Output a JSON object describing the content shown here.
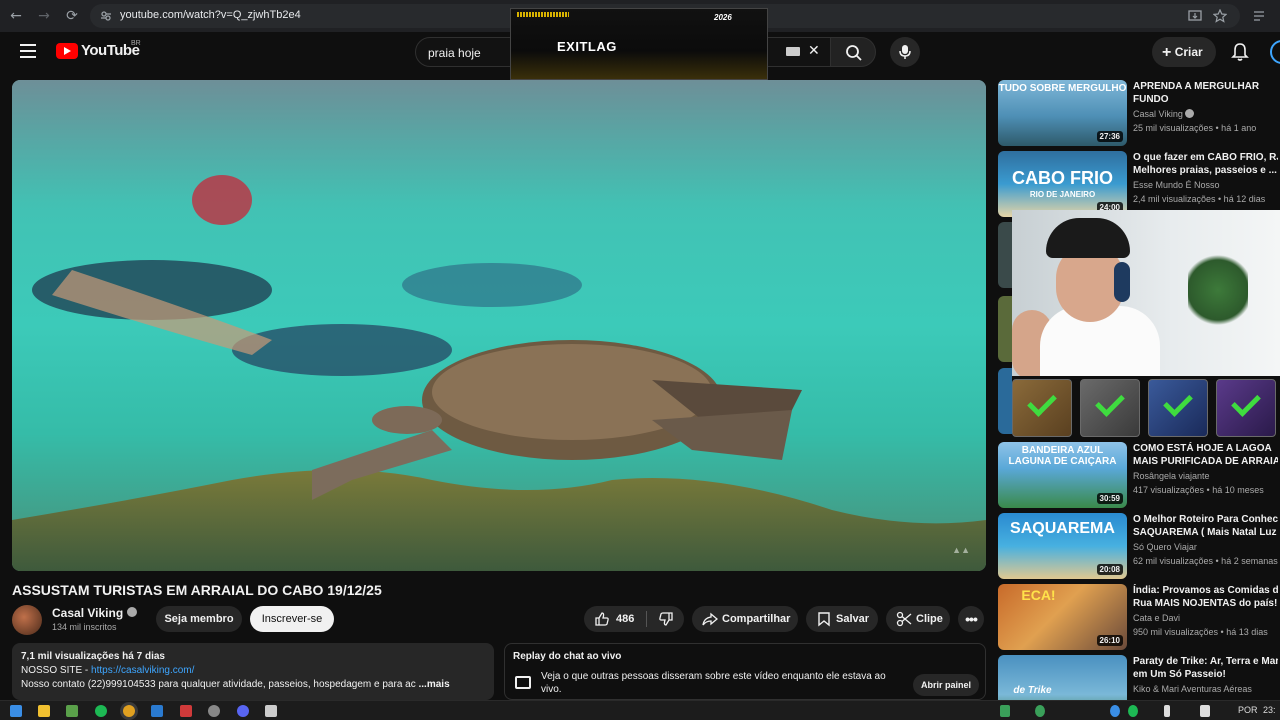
{
  "browser": {
    "url": "youtube.com/watch?v=Q_zjwhTb2e4",
    "back_icon": "arrow-left-icon",
    "forward_icon": "arrow-right-icon",
    "reload_icon": "reload-icon"
  },
  "header": {
    "logo_text": "YouTube",
    "country_code": "BR",
    "search_value": "praia hoje",
    "create_label": "Criar"
  },
  "overlay": {
    "brand": "EXITLAG",
    "year": "2026"
  },
  "video": {
    "title": "ASSUSTAM TURISTAS EM ARRAIAL DO CABO 19/12/25"
  },
  "channel": {
    "name": "Casal Viking",
    "subscribers": "134 mil inscritos",
    "member_label": "Seja membro",
    "subscribe_label": "Inscrever-se"
  },
  "actions": {
    "likes": "486",
    "share_label": "Compartilhar",
    "save_label": "Salvar",
    "clip_label": "Clipe"
  },
  "description": {
    "meta": "7,1 mil visualizações  há 7 dias",
    "site_prefix": "NOSSO SITE - ",
    "site_link": "https://casalviking.com/",
    "contact": "Nosso contato (22)999104533 para qualquer atividade, passeios, hospedagem e para ac",
    "more_label": "...mais"
  },
  "chat_replay": {
    "title": "Replay do chat ao vivo",
    "text": "Veja o que outras pessoas disseram sobre este vídeo enquanto ele estava ao vivo.",
    "open_label": "Abrir painel"
  },
  "recommendations": [
    {
      "thumb_text": "TUDO SOBRE MERGULHO",
      "duration": "27:36",
      "title_lines": [
        "APRENDA A MERGULHAR",
        "FUNDO"
      ],
      "channel": "Casal Viking",
      "views": "25 mil visualizações • há 1 ano"
    },
    {
      "thumb_text": "CABO FRIO",
      "thumb_sub": "RIO DE JANEIRO",
      "duration": "24:00",
      "title_lines": [
        "O que fazer em CABO FRIO, RJ",
        "Melhores praias, passeios e ..."
      ],
      "channel": "Esse Mundo É Nosso",
      "views": "2,4 mil visualizações • há 12 dias"
    },
    {
      "thumb_text": "BANDEIRA AZUL LAGUNA DE CAIÇARA",
      "duration": "30:59",
      "title_lines": [
        "COMO ESTÁ HOJE A LAGOA",
        "MAIS PURIFICADA DE ARRAIA"
      ],
      "channel": "Rosângela viajante",
      "views": "417 visualizações • há 10 meses"
    },
    {
      "thumb_text": "SAQUAREMA",
      "duration": "20:08",
      "title_lines": [
        "O Melhor Roteiro Para Conhecer",
        "SAQUAREMA ( Mais Natal Luz"
      ],
      "channel": "Só Quero Viajar",
      "views": "62 mil visualizações • há 2 semanas"
    },
    {
      "thumb_text": "ECA!",
      "duration": "26:10",
      "title_lines": [
        "Índia: Provamos as Comidas de",
        "Rua MAIS NOJENTAS do país!"
      ],
      "channel": "Cata e Davi",
      "views": "950 mil visualizações • há 13 dias"
    },
    {
      "thumb_text": "de Trike",
      "duration": "",
      "title_lines": [
        "Paraty de Trike: Ar, Terra e Mar",
        "em Um Só Passeio!"
      ],
      "channel": "Kiko & Mari Aventuras Aéreas",
      "views": ""
    }
  ],
  "taskbar": {
    "language": "POR",
    "time": "23:"
  }
}
